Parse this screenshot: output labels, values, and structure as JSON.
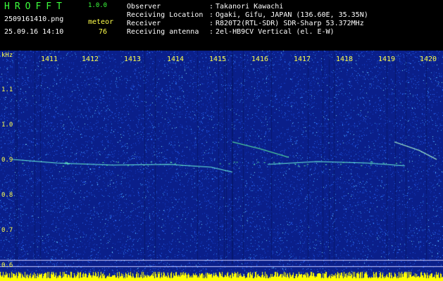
{
  "header": {
    "app_title": "HROFFT",
    "app_version": "1.0.0",
    "file_name": "2509161410.png",
    "meteor_label": "meteor",
    "datetime": "25.09.16 14:10",
    "meteor_count": "76",
    "info": [
      {
        "key": "Observer",
        "value": "Takanori Kawachi"
      },
      {
        "key": "Receiving Location",
        "value": "Ogaki, Gifu, JAPAN (136.60E, 35.35N)"
      },
      {
        "key": "Receiver",
        "value": "R820T2(RTL-SDR) SDR-Sharp 53.372MHz"
      },
      {
        "key": "Receiving antenna",
        "value": "2el-HB9CV Vertical (el. E-W)"
      }
    ],
    "separator": ":"
  },
  "spectrogram": {
    "unit_label": "kHz",
    "time_ticks": [
      "1411",
      "1412",
      "1413",
      "1414",
      "1415",
      "1416",
      "1417",
      "1418",
      "1419",
      "1420"
    ],
    "freq_ticks": [
      "1.1",
      "1.0",
      "0.9",
      "0.8",
      "0.7",
      "0.6"
    ],
    "colors": {
      "background": "#0a1f8a",
      "noise": "#2a6cff",
      "echo": "#5cf0a0",
      "level_bar": "#ffff00",
      "label": "#ffff4a"
    }
  }
}
